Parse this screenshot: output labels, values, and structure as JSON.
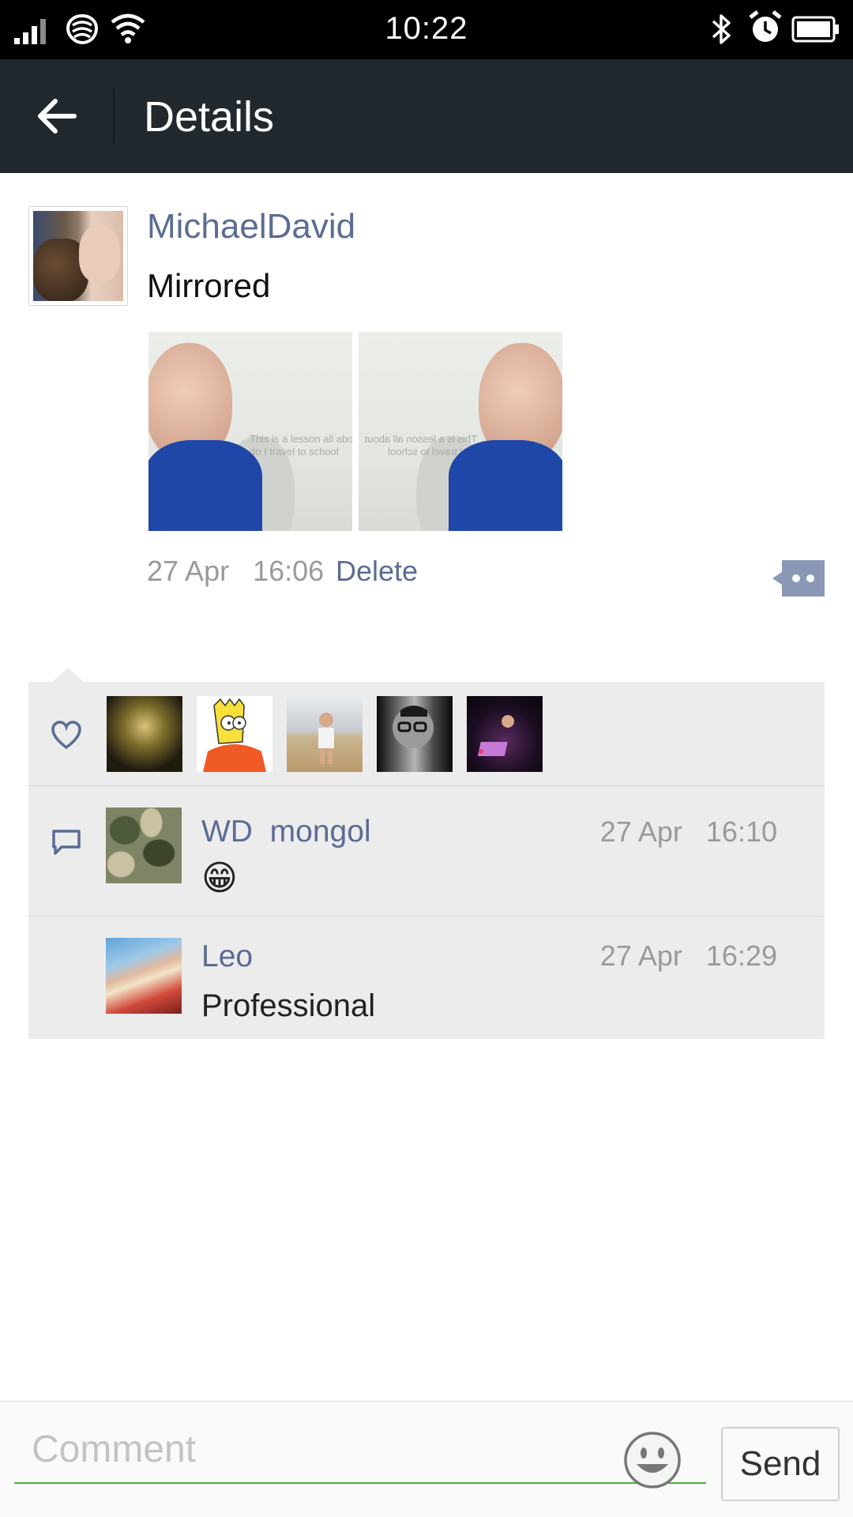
{
  "status_bar": {
    "time": "10:22",
    "icons": [
      "signal-icon",
      "network-icon",
      "wifi-icon",
      "bluetooth-icon",
      "alarm-icon",
      "battery-icon"
    ]
  },
  "app_bar": {
    "title": "Details",
    "back_icon": "arrow-left-icon"
  },
  "post": {
    "author": "MichaelDavid",
    "text": "Mirrored",
    "photos": [
      "photo-original",
      "photo-mirrored"
    ],
    "photo_caption_text": "This is a lesson all about do I travel to school",
    "date": "27 Apr",
    "time": "16:06",
    "delete_label": "Delete",
    "more_icon": "comment-more-icon"
  },
  "likes": {
    "icon": "heart-icon",
    "avatars": [
      "guitarist-avatar",
      "cartoon-avatar",
      "child-avatar",
      "glasses-man-avatar",
      "dj-avatar"
    ]
  },
  "comments": [
    {
      "name": "WD  mongol",
      "date": "27 Apr",
      "time": "16:10",
      "text": "😁"
    },
    {
      "name": "Leo",
      "date": "27 Apr",
      "time": "16:29",
      "text": "Professional"
    }
  ],
  "composer": {
    "placeholder": "Comment",
    "value": "",
    "send_label": "Send",
    "emoji_icon": "smiley-icon"
  },
  "colors": {
    "app_bar": "#22292e",
    "link": "#5b6c94",
    "panel": "#ececec",
    "input_underline": "#45b035"
  }
}
